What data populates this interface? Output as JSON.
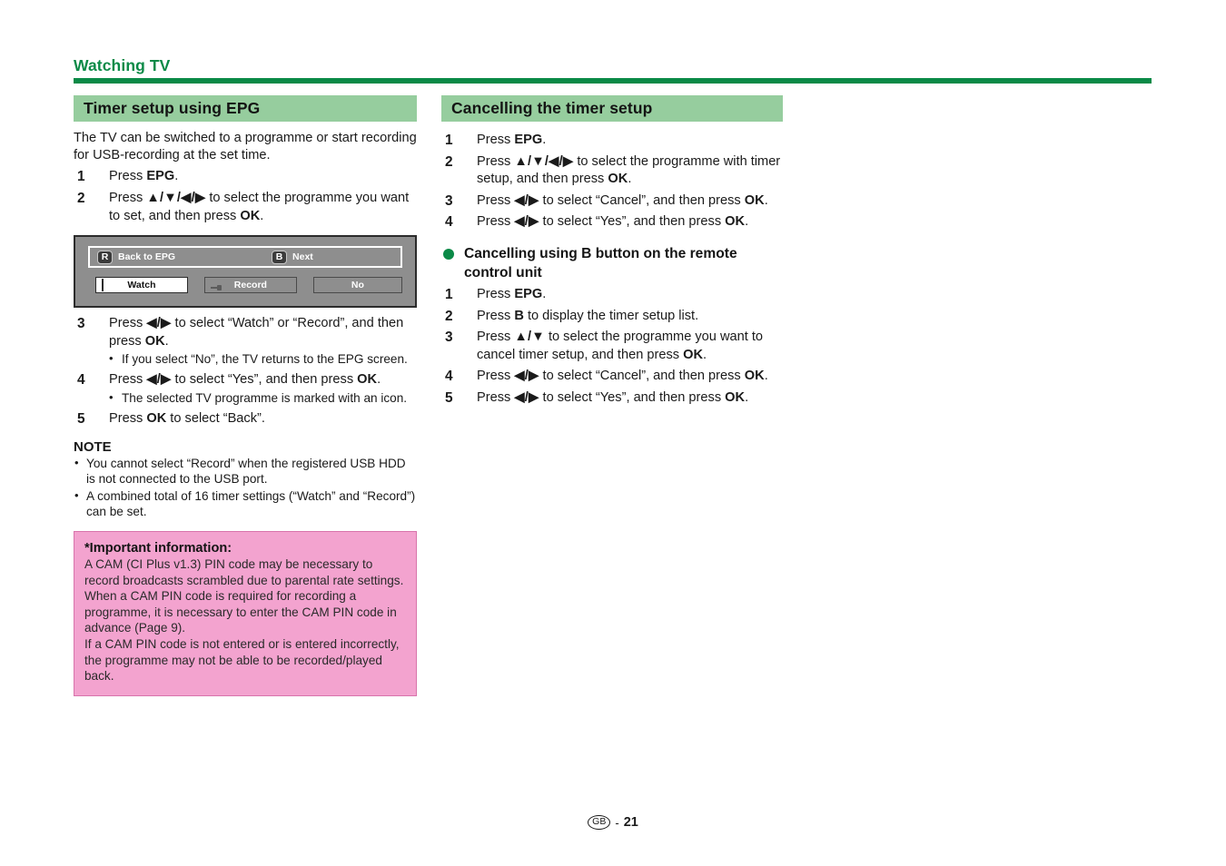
{
  "running_head": "Watching TV",
  "accent_colors": {
    "dark_green": "#0b8a47",
    "band_green": "#96cd9e",
    "pink_fill": "#f3a3cf",
    "pink_border": "#d874ab",
    "panel_gray": "#8e8e8e"
  },
  "left_column": {
    "section_title": "Timer setup using EPG",
    "intro": "The TV can be switched to a programme or start recording for USB-recording at the set time.",
    "steps_before_figure": [
      {
        "num": "1",
        "text_before": "Press ",
        "bold": "EPG",
        "text_after": "."
      },
      {
        "num": "2",
        "text_before": "Press ",
        "arrows": "▲/▼/◀/▶",
        "mid": " to select the programme you want to set, and then press ",
        "bold": "OK",
        "text_after": "."
      }
    ],
    "figure": {
      "top_bar": [
        {
          "key": "R",
          "label": "Back to EPG"
        },
        {
          "key": "B",
          "label": "Next"
        }
      ],
      "buttons": [
        {
          "label": "Watch",
          "state": "selected",
          "icon": "tv-icon"
        },
        {
          "label": "Record",
          "state": "normal",
          "icon": "usb-icon"
        },
        {
          "label": "No",
          "state": "normal",
          "icon": "none"
        }
      ]
    },
    "steps_after_figure": [
      {
        "num": "3",
        "text_before": "Press ",
        "arrows": "◀/▶",
        "mid": " to select “Watch” or “Record”, and then press ",
        "bold": "OK",
        "text_after": ".",
        "sub": "If you select “No”, the TV returns to the EPG screen."
      },
      {
        "num": "4",
        "text_before": "Press ",
        "arrows": "◀/▶",
        "mid": " to select “Yes”, and then press ",
        "bold": "OK",
        "text_after": ".",
        "sub": "The selected TV programme is marked with an icon."
      },
      {
        "num": "5",
        "text_before": "Press ",
        "bold": "OK",
        "text_after": " to select “Back”."
      }
    ],
    "note_title": "NOTE",
    "notes": [
      "You cannot select “Record” when the registered USB HDD is not connected to the USB port.",
      "A combined total of 16 timer settings (“Watch” and “Record”) can be set."
    ],
    "important_box": {
      "title": "*Important information:",
      "paragraphs": [
        "A CAM (CI Plus v1.3) PIN code may be necessary to record broadcasts scrambled due to parental rate settings.",
        "When a CAM PIN code is required for recording a programme, it is necessary to enter the CAM PIN code in advance (Page 9).",
        "If a CAM PIN code is not entered or is entered incorrectly, the programme may not be able to be recorded/played back."
      ]
    }
  },
  "right_column": {
    "section_title": "Cancelling the timer setup",
    "steps": [
      {
        "num": "1",
        "text_before": "Press ",
        "bold": "EPG",
        "text_after": "."
      },
      {
        "num": "2",
        "text_before": "Press ",
        "arrows": "▲/▼/◀/▶",
        "mid": " to select the programme with timer setup, and then press ",
        "bold": "OK",
        "text_after": "."
      },
      {
        "num": "3",
        "text_before": "Press ",
        "arrows": "◀/▶",
        "mid": " to select “Cancel”, and then press ",
        "bold": "OK",
        "text_after": "."
      },
      {
        "num": "4",
        "text_before": "Press ",
        "arrows": "◀/▶",
        "mid": " to select “Yes”, and then press ",
        "bold": "OK",
        "text_after": "."
      }
    ],
    "sub_section": {
      "heading": "Cancelling using B button on the remote control unit",
      "steps": [
        {
          "num": "1",
          "text_before": "Press ",
          "bold": "EPG",
          "text_after": "."
        },
        {
          "num": "2",
          "text_before": "Press ",
          "bold": "B",
          "text_after": " to display the timer setup list."
        },
        {
          "num": "3",
          "text_before": "Press ",
          "arrows": "▲/▼",
          "mid": " to select the programme you want to cancel timer setup, and then press ",
          "bold": "OK",
          "text_after": "."
        },
        {
          "num": "4",
          "text_before": "Press ",
          "arrows": "◀/▶",
          "mid": " to select “Cancel”, and then press ",
          "bold": "OK",
          "text_after": "."
        },
        {
          "num": "5",
          "text_before": "Press ",
          "arrows": "◀/▶",
          "mid": " to select “Yes”, and then press ",
          "bold": "OK",
          "text_after": "."
        }
      ]
    }
  },
  "footer": {
    "region": "GB",
    "dash": "-",
    "page_number": "21"
  }
}
